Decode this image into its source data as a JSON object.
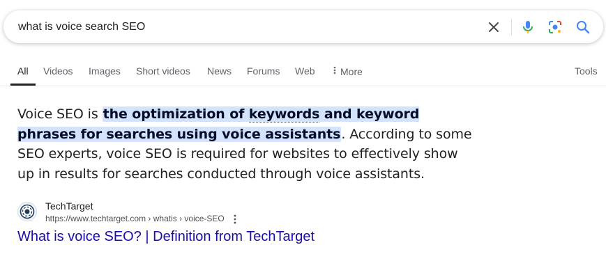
{
  "search": {
    "query": "what is voice search SEO"
  },
  "tabs": [
    {
      "label": "All"
    },
    {
      "label": "Videos"
    },
    {
      "label": "Images"
    },
    {
      "label": "Short videos"
    },
    {
      "label": "News"
    },
    {
      "label": "Forums"
    },
    {
      "label": "Web"
    },
    {
      "label": "More"
    }
  ],
  "tools_label": "Tools",
  "snippet": {
    "prefix": "Voice SEO is ",
    "highlight_1": "the optimization of ",
    "highlight_keywords": "keywords",
    "highlight_2": " and keyword phrases for searches using voice assistants",
    "suffix": ". According to some SEO experts, voice SEO is required for websites to effectively show up in results for searches conducted through voice assistants."
  },
  "result": {
    "site_name": "TechTarget",
    "url": "https://www.techtarget.com › whatis › voice-SEO",
    "title": "What is voice SEO? | Definition from TechTarget"
  },
  "colors": {
    "highlight": "#d3e3fd",
    "link": "#1a0dab",
    "text": "#202124",
    "muted": "#5f6368"
  }
}
